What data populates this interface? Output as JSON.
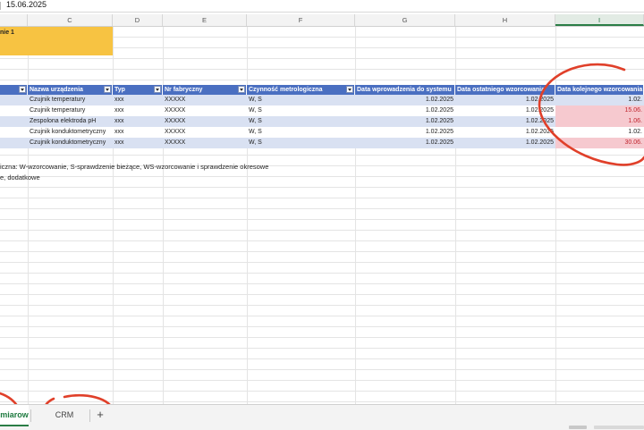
{
  "formula": {
    "value": "15.06.2025"
  },
  "columns": [
    "C",
    "D",
    "E",
    "F",
    "G",
    "H",
    "I"
  ],
  "active_column": "I",
  "header_cell": {
    "text": "nie 1",
    "color": "#f7c342"
  },
  "table": {
    "header_color": "#4a6fc1",
    "headers": [
      "Nazwa urządzenia",
      "Typ",
      "Nr fabryczny",
      "Czynność metrologiczna",
      "Data wprowadzenia do systemu",
      "Data ostatniego wzorcowania",
      "Data kolejnego wzorcowania"
    ],
    "rows": [
      {
        "band": "#d9e1f2",
        "cells": [
          "Czujnik temperatury",
          "xxx",
          "XXXXX",
          "W, S",
          "1.02.2025",
          "1.02.2025",
          "1.02."
        ],
        "last_style": ""
      },
      {
        "band": "#ffffff",
        "cells": [
          "Czujnik temperatury",
          "xxx",
          "XXXXX",
          "W, S",
          "1.02.2025",
          "1.02.2025",
          "15.06."
        ],
        "last_style": "red pink"
      },
      {
        "band": "#d9e1f2",
        "cells": [
          "Zespolona elektroda pH",
          "xxx",
          "XXXXX",
          "W, S",
          "1.02.2025",
          "1.02.2025",
          "1.06."
        ],
        "last_style": "red pink"
      },
      {
        "band": "#ffffff",
        "cells": [
          "Czujnik konduktometryczny",
          "xxx",
          "XXXXX",
          "W, S",
          "1.02.2025",
          "1.02.2025",
          "1.02."
        ],
        "last_style": ""
      },
      {
        "band": "#d9e1f2",
        "cells": [
          "Czujnik konduktometryczny",
          "xxx",
          "XXXXX",
          "W, S",
          "1.02.2025",
          "1.02.2025",
          "30.06."
        ],
        "last_style": "red pink"
      }
    ]
  },
  "notes": [
    "iczna: W-wzorcowanie, S-sprawdzenie bieżące, WS-wzorcowanie i sprawdzenie okresowe",
    "e, dodatkowe"
  ],
  "tabs": [
    {
      "label": "miarow",
      "active": true
    },
    {
      "label": "CRM",
      "active": false
    }
  ],
  "add_tab_label": "+",
  "annotation_color": "#e0402a"
}
